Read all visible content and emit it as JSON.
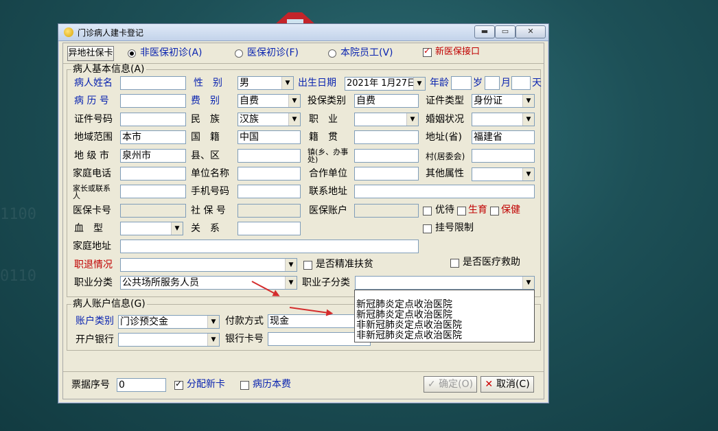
{
  "window": {
    "title": "门诊病人建卡登记",
    "btn_min": "▬",
    "btn_max": "▭",
    "btn_close": "✕"
  },
  "topbar": {
    "remote_btn": "异地社保卡",
    "radio1": "非医保初诊(A)",
    "radio2": "医保初诊(F)",
    "radio3": "本院员工(V)",
    "new_interface": "新医保接口"
  },
  "basic": {
    "group_title": "病人基本信息(A)",
    "name_label": "病人姓名",
    "name_value": "",
    "gender_label": "性　别",
    "gender_value": "男",
    "dob_label": "出生日期",
    "dob_value": "2021年 1月27日",
    "age_label": "年龄",
    "age_y": "岁",
    "age_m": "月",
    "age_d": "天",
    "record_label": "病 历 号",
    "record_value": "",
    "fee_label": "费　别",
    "fee_value": "自费",
    "ins_type_label": "投保类别",
    "ins_type_value": "自费",
    "cert_type_label": "证件类型",
    "cert_type_value": "身份证",
    "cert_no_label": "证件号码",
    "cert_no_value": "",
    "ethnic_label": "民　族",
    "ethnic_value": "汉族",
    "job_label": "职　业",
    "job_value": "",
    "marital_label": "婚姻状况",
    "marital_value": "",
    "region_label": "地域范围",
    "region_value": "本市",
    "nation_label": "国　籍",
    "nation_value": "中国",
    "origin_label": "籍　贯",
    "origin_value": "",
    "province_label": "地址(省)",
    "province_value": "福建省",
    "city_label": "地 级 市",
    "city_value": "泉州市",
    "county_label": "县、区",
    "county_value": "",
    "town_label": "镇(乡、办事处)",
    "town_value": "",
    "village_label": "村(居委会)",
    "village_value": "",
    "home_phone_label": "家庭电话",
    "home_phone_value": "",
    "employer_label": "单位名称",
    "employer_value": "",
    "coop_label": "合作单位",
    "coop_value": "",
    "other_label": "其他属性",
    "other_value": "",
    "guardian_label": "家长或联系人",
    "guardian_value": "",
    "mobile_label": "手机号码",
    "mobile_value": "",
    "contact_addr_label": "联系地址",
    "contact_addr_value": "",
    "ins_card_label": "医保卡号",
    "ins_card_value": "",
    "social_label": "社 保 号",
    "social_value": "",
    "ins_acct_label": "医保账户",
    "ins_acct_value": "",
    "chk_priority": "优待",
    "chk_birth": "生育",
    "chk_health": "保健",
    "blood_label": "血　型",
    "blood_value": "",
    "relation_label": "关　系",
    "relation_value": "",
    "chk_reg_limit": "挂号限制",
    "home_addr_label": "家庭地址",
    "home_addr_value": "",
    "retire_label": "职退情况",
    "retire_value": "",
    "chk_poverty": "是否精准扶贫",
    "chk_aid": "是否医疗救助",
    "occ_class_label": "职业分类",
    "occ_class_value": "公共场所服务人员",
    "occ_sub_label": "职业子分类",
    "occ_sub_value": ""
  },
  "dropdown_options": [
    "新冠肺炎定点收治医院",
    "新冠肺炎定点收治医院",
    "非新冠肺炎定点收治医院",
    "非新冠肺炎定点收治医院"
  ],
  "account": {
    "group_title": "病人账户信息(G)",
    "acct_type_label": "账户类别",
    "acct_type_value": "门诊预交金",
    "pay_label": "付款方式",
    "pay_value": "现金",
    "bank_label": "开户银行",
    "bank_value": "",
    "bank_card_label": "银行卡号",
    "bank_card_value": ""
  },
  "footer": {
    "receipt_label": "票据序号",
    "receipt_value": "0",
    "chk_new_card": "分配新卡",
    "chk_record_fee": "病历本费",
    "ok_label": "确定(O)",
    "cancel_label": "取消(C)"
  },
  "colors": {
    "label_blue": "#0a24b0",
    "label_red": "#c00000",
    "arrow_red": "#d42d2d"
  }
}
